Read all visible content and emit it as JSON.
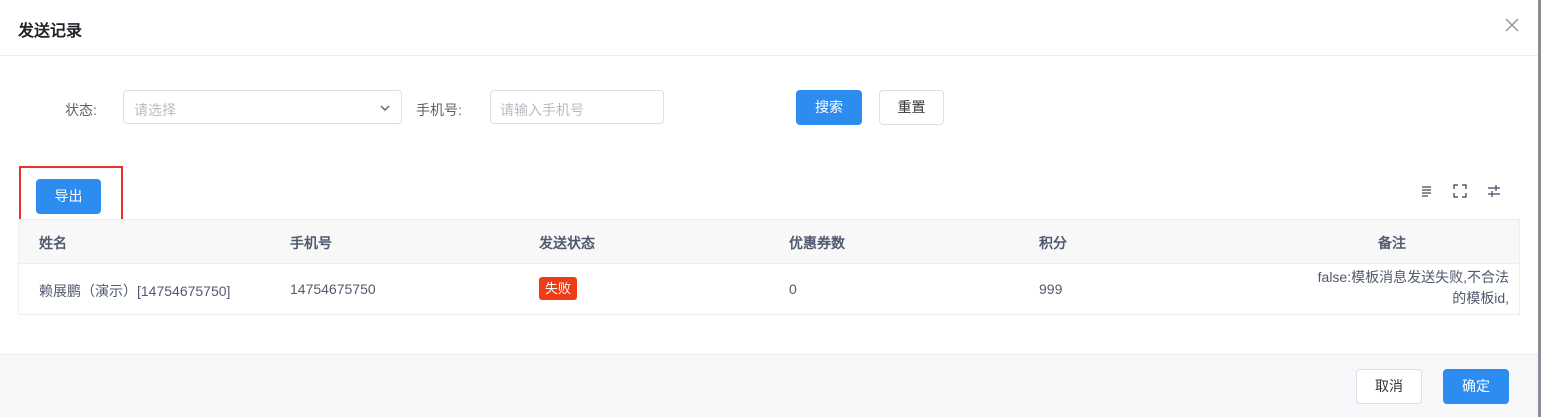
{
  "dialog": {
    "title": "发送记录"
  },
  "filters": {
    "status_label": "状态:",
    "status_placeholder": "请选择",
    "phone_label": "手机号:",
    "phone_placeholder": "请输入手机号",
    "search_label": "搜索",
    "reset_label": "重置"
  },
  "toolbar": {
    "export_label": "导出",
    "icons": [
      "density-icon",
      "fullscreen-icon",
      "column-settings-icon"
    ]
  },
  "table": {
    "columns": [
      "姓名",
      "手机号",
      "发送状态",
      "优惠券数",
      "积分",
      "备注"
    ],
    "rows": [
      {
        "name": "赖展鹏（演示）[14754675750]",
        "phone": "14754675750",
        "status": "失败",
        "coupons": "0",
        "points": "999",
        "remark_line1": "false:模板消息发送失败,不合法",
        "remark_line2": "的模板id,"
      }
    ]
  },
  "footer": {
    "cancel_label": "取消",
    "confirm_label": "确定"
  },
  "colors": {
    "primary": "#2d8cf0",
    "danger_badge": "#ee3d16",
    "highlight_border": "#e8312b"
  }
}
